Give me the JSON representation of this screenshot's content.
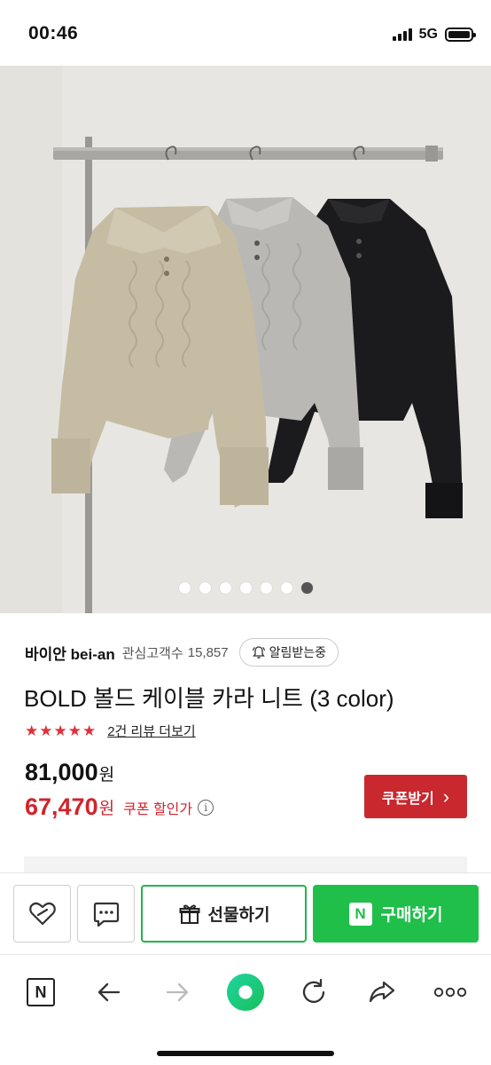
{
  "status": {
    "time": "00:46",
    "network": "5G"
  },
  "gallery": {
    "total": 7,
    "active_index": 6
  },
  "seller": {
    "name": "바이안 bei-an",
    "follower_label": "관심고객수",
    "follower_count": "15,857",
    "alarm_label": "알림받는중"
  },
  "product": {
    "title": "BOLD 볼드 케이블 카라 니트 (3 color)",
    "stars": "★★★★★",
    "review_link": "2건 리뷰 더보기",
    "price_original": "81,000",
    "price_sale": "67,470",
    "currency": "원",
    "sale_label": "쿠폰 할인가",
    "info_icon": "i",
    "coupon_button": "쿠폰받기",
    "coupon_arrow": "›"
  },
  "actions": {
    "gift_label": "선물하기",
    "buy_label": "구매하기",
    "buy_badge": "N"
  },
  "browser": {
    "home_badge": "N"
  },
  "colors": {
    "sale_red": "#d2242d",
    "coupon_red": "#c8282e",
    "naver_green": "#1fbf4a",
    "star_red": "#e0303b"
  },
  "icons": [
    "heart-outline-icon",
    "chat-bubble-icon",
    "gift-icon",
    "naver-n-icon",
    "back-arrow-icon",
    "forward-arrow-icon",
    "green-dot-icon",
    "refresh-icon",
    "share-icon",
    "more-icon",
    "bell-icon",
    "info-icon"
  ]
}
